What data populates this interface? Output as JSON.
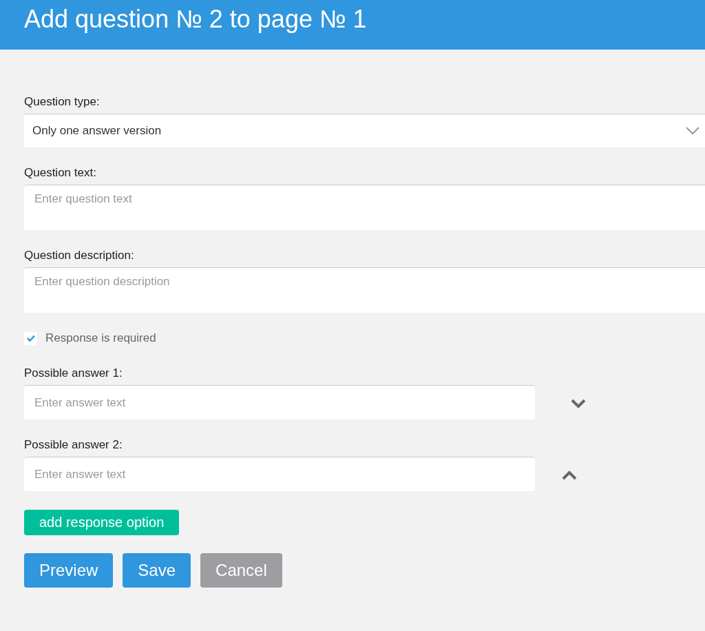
{
  "header": {
    "title": "Add question № 2 to page № 1"
  },
  "question_type": {
    "label": "Question type:",
    "value": "Only one answer version"
  },
  "question_text": {
    "label": "Question text:",
    "placeholder": "Enter question text"
  },
  "question_description": {
    "label": "Question description:",
    "placeholder": "Enter question description"
  },
  "required": {
    "label": "Response is required",
    "checked": true
  },
  "answers": [
    {
      "label": "Possible answer 1:",
      "placeholder": "Enter answer text",
      "kind": "move_down"
    },
    {
      "label": "Possible answer 2:",
      "placeholder": "Enter answer text",
      "kind": "move_up"
    }
  ],
  "add_button": "add response option",
  "buttons": [
    {
      "label": "Preview",
      "kind": "primary"
    },
    {
      "label": "Save",
      "kind": "primary"
    },
    {
      "label": "Cancel",
      "kind": "secondary"
    }
  ]
}
